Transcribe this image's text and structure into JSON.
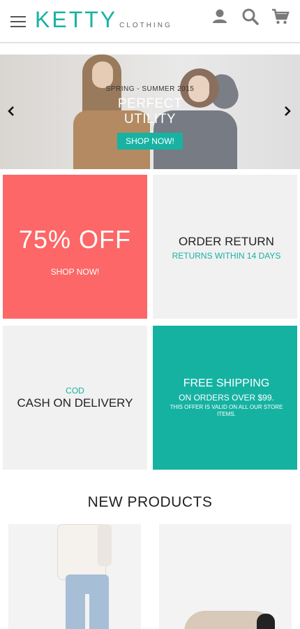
{
  "brand": {
    "name": "KETTY",
    "tagline": "CLOTHING",
    "accent": "#17b2a2"
  },
  "header": {
    "icons": [
      "menu-icon",
      "user-icon",
      "search-icon",
      "cart-icon"
    ]
  },
  "slider": {
    "kicker": "SPRING - SUMMER 2015",
    "title_line1": "PERFECT",
    "title_line2": "UTILITY",
    "button": "SHOP NOW!"
  },
  "promos": {
    "sale": {
      "big": "75% OFF",
      "button": "SHOP NOW!",
      "color": "#fd6767"
    },
    "return": {
      "title": "ORDER RETURN",
      "subtitle": "RETURNS WITHIN 14 DAYS"
    },
    "cod": {
      "kicker": "COD",
      "title": "CASH ON DELIVERY"
    },
    "shipping": {
      "title": "FREE SHIPPING",
      "subtitle": "ON ORDERS OVER $99.",
      "note": "THIS OFFER IS VALID ON ALL OUR STORE ITEMS.",
      "color": "#15b2a2"
    }
  },
  "new_products": {
    "title": "NEW PRODUCTS"
  }
}
